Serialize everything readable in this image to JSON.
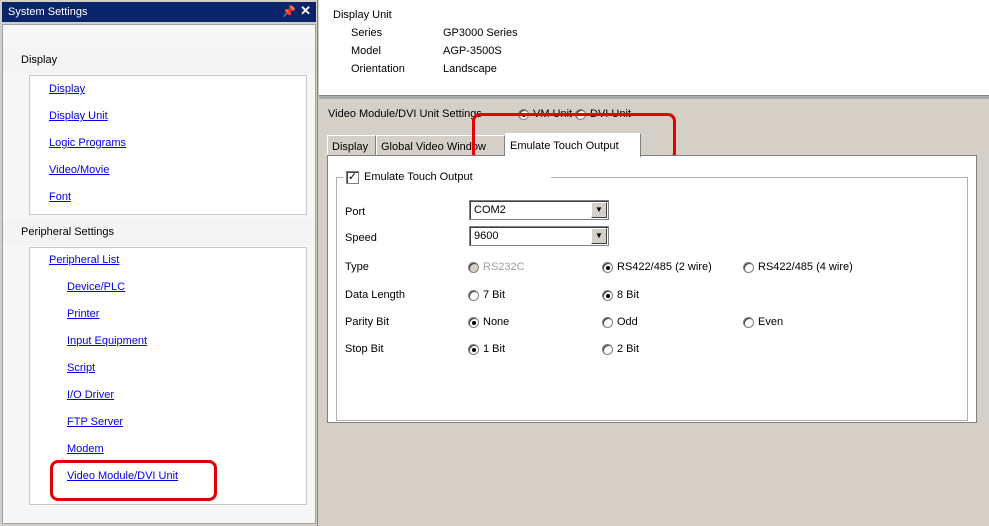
{
  "left_panel": {
    "title": "System Settings",
    "pin_glyph": "↔",
    "close_glyph": "✕",
    "display_group": {
      "header": "Display",
      "items": [
        "Display",
        "Display Unit",
        "Logic Programs",
        "Video/Movie",
        "Font"
      ]
    },
    "peripheral_group": {
      "header": "Peripheral Settings",
      "top_item": "Peripheral List",
      "items": [
        "Device/PLC",
        "Printer",
        "Input Equipment",
        "Script",
        "I/O Driver",
        "FTP Server",
        "Modem",
        "Video Module/DVI Unit"
      ]
    }
  },
  "unit_info": {
    "heading": "Display Unit",
    "rows": [
      {
        "label": "Series",
        "value": "GP3000 Series"
      },
      {
        "label": "Model",
        "value": "AGP-3500S"
      },
      {
        "label": "Orientation",
        "value": "Landscape"
      }
    ]
  },
  "settings": {
    "mode_label": "Video Module/DVI Unit Settings",
    "mode_options": [
      "VM Unit",
      "DVI Unit"
    ],
    "mode_selected": "VM Unit",
    "tabs": [
      "Display",
      "Global Video Window",
      "Emulate Touch Output"
    ],
    "active_tab": "Emulate Touch Output",
    "emulate_checkbox_label": "Emulate Touch Output",
    "emulate_checked": true,
    "port_label": "Port",
    "port_value": "COM2",
    "speed_label": "Speed",
    "speed_value": "9600",
    "type_label": "Type",
    "type_options": [
      "RS232C",
      "RS422/485 (2 wire)",
      "RS422/485 (4 wire)"
    ],
    "type_selected": "RS422/485 (2 wire)",
    "data_length_label": "Data Length",
    "data_length_options": [
      "7 Bit",
      "8 Bit"
    ],
    "data_length_selected": "8 Bit",
    "parity_label": "Parity Bit",
    "parity_options": [
      "None",
      "Odd",
      "Even"
    ],
    "parity_selected": "None",
    "stop_label": "Stop Bit",
    "stop_options": [
      "1 Bit",
      "2 Bit"
    ],
    "stop_selected": "1 Bit"
  },
  "colors": {
    "highlight_red": "#e30000",
    "title_bar": "#0a246a",
    "link": "#0000ee"
  }
}
